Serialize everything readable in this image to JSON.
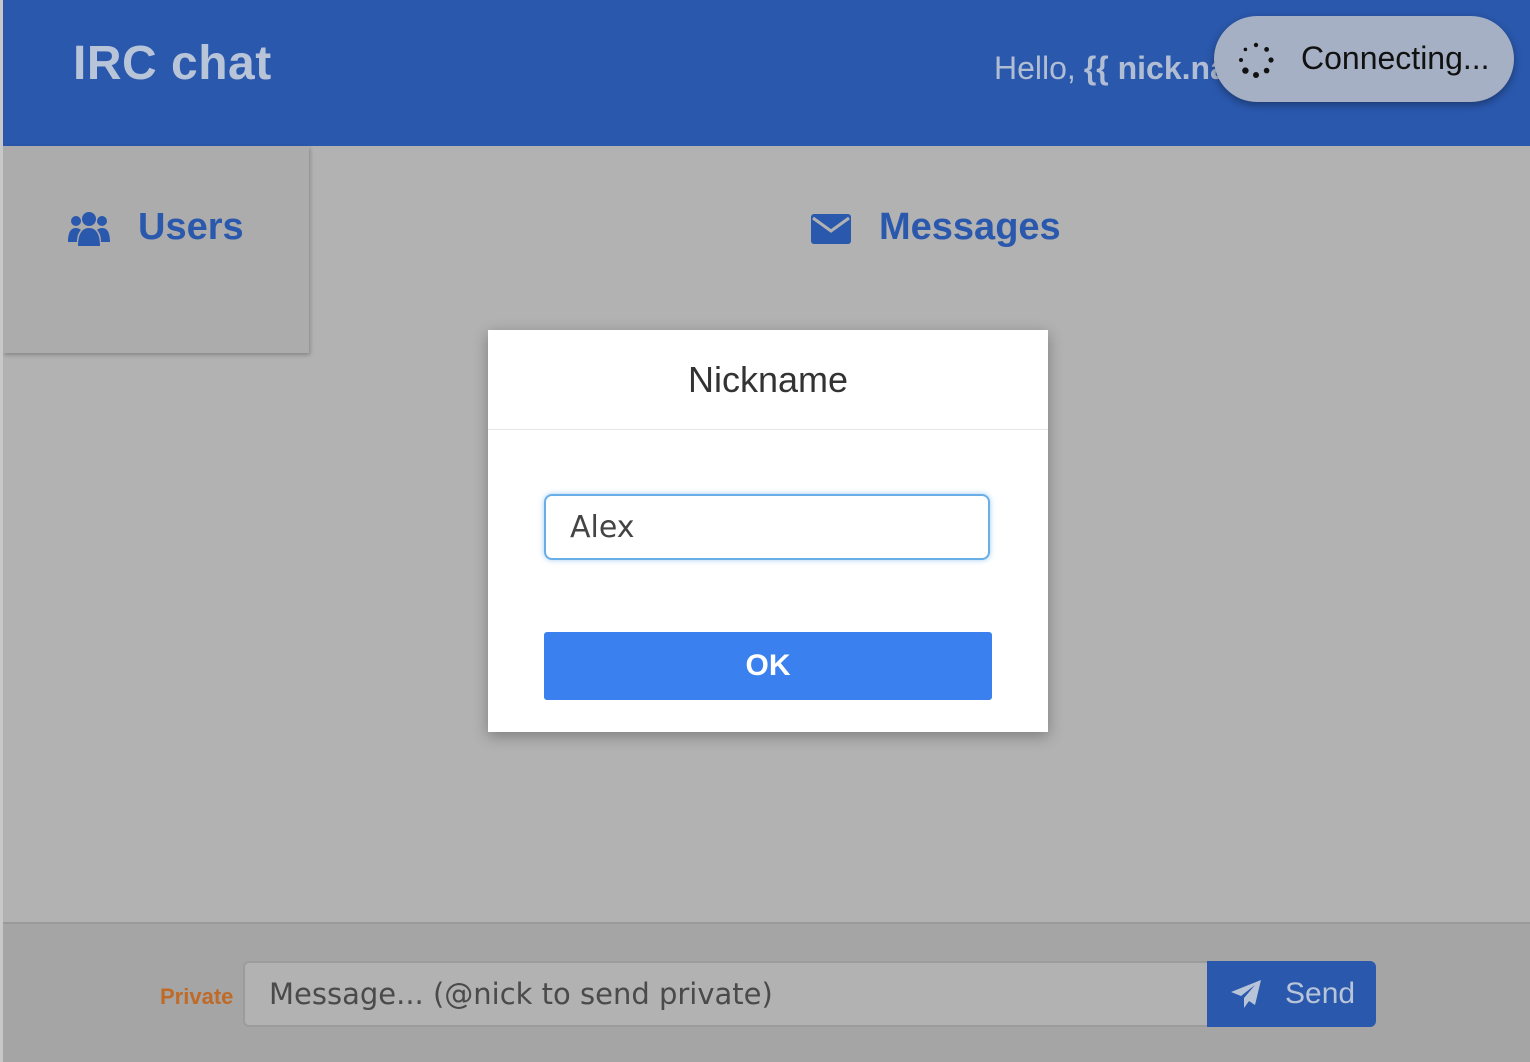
{
  "header": {
    "brand": "IRC chat",
    "greeting": "Hello,",
    "nick_template": "{{ nick.name }}"
  },
  "status": {
    "connecting_text": "Connecting..."
  },
  "users_panel": {
    "title": "Users"
  },
  "messages_panel": {
    "title": "Messages"
  },
  "modal": {
    "title": "Nickname",
    "input_value": "Alex",
    "ok_label": "OK"
  },
  "footer": {
    "private_label": "Private",
    "message_placeholder": "Message... (@nick to send private)",
    "send_label": "Send"
  },
  "icons": {
    "users": "users-group-icon",
    "messages": "envelope-icon",
    "send": "paper-plane-icon",
    "edit": "pencil-icon",
    "spinner": "loading-spinner-icon"
  },
  "colors": {
    "header_bg": "#2a58ad",
    "accent": "#3a80ee",
    "private_label": "#bf6a27",
    "backdrop": "#b2b2b2"
  }
}
